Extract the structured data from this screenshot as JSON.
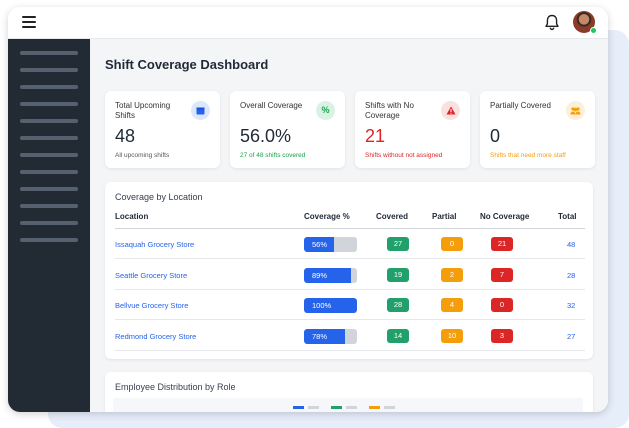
{
  "page_title": "Shift Coverage Dashboard",
  "stats": [
    {
      "label": "Total Upcoming Shifts",
      "value": "48",
      "sub": "All upcoming shifts",
      "icon": "calendar-icon",
      "sub_color": "#555555"
    },
    {
      "label": "Overall Coverage",
      "value": "56.0%",
      "sub": "27 of 48 shifts covered",
      "icon": "percent-icon",
      "sub_color": "#16a34a"
    },
    {
      "label": "Shifts with No Coverage",
      "value": "21",
      "sub": "Shifts without not assigned",
      "icon": "alert-icon",
      "sub_color": "#dc2626"
    },
    {
      "label": "Partially Covered",
      "value": "0",
      "sub": "Shifts that need more staff",
      "icon": "users-icon",
      "sub_color": "#f59e0b"
    }
  ],
  "location_section": {
    "title": "Coverage by Location",
    "headers": {
      "location": "Location",
      "coverage": "Coverage %",
      "covered": "Covered",
      "partial": "Partial",
      "no_coverage": "No Coverage",
      "total": "Total"
    },
    "rows": [
      {
        "location": "Issaquah Grocery Store",
        "coverage_pct": 56,
        "coverage": "56%",
        "covered": "27",
        "partial": "0",
        "no_coverage": "21",
        "total": "48"
      },
      {
        "location": "Seattle Grocery Store",
        "coverage_pct": 89,
        "coverage": "89%",
        "covered": "19",
        "partial": "2",
        "no_coverage": "7",
        "total": "28"
      },
      {
        "location": "Bellvue Grocery Store",
        "coverage_pct": 100,
        "coverage": "100%",
        "covered": "28",
        "partial": "4",
        "no_coverage": "0",
        "total": "32"
      },
      {
        "location": "Redmond Grocery Store",
        "coverage_pct": 78,
        "coverage": "78%",
        "covered": "14",
        "partial": "10",
        "no_coverage": "3",
        "total": "27"
      }
    ]
  },
  "distribution_section": {
    "title": "Employee Distribution by Role"
  },
  "colors": {
    "accent": "#2563eb",
    "success": "#22a06b",
    "warning": "#f59e0b",
    "danger": "#dc2626",
    "sidebar": "#222a33"
  }
}
